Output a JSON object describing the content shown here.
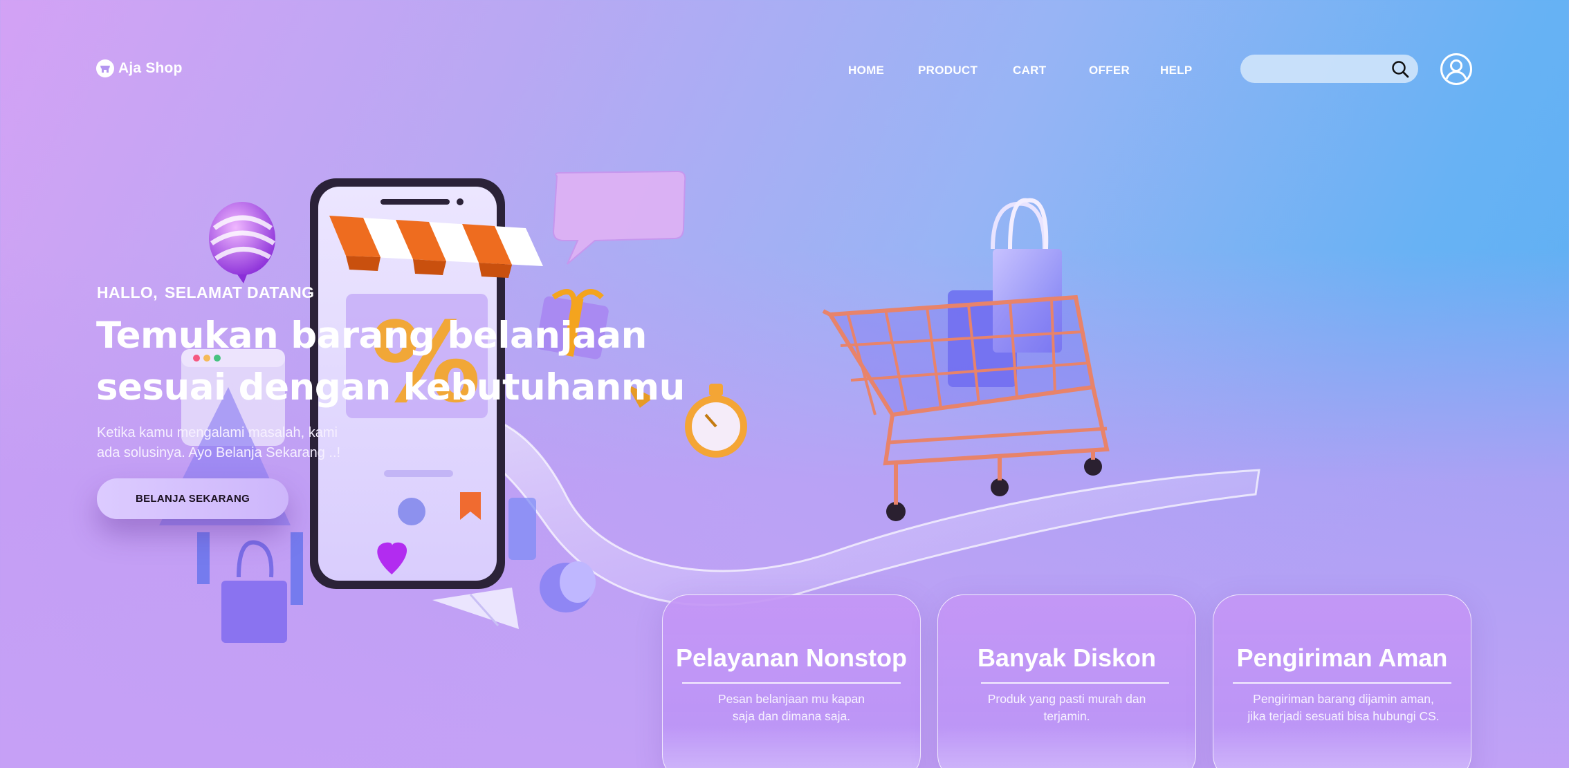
{
  "brand": {
    "name": "Aja Shop",
    "icon": "shop-icon"
  },
  "nav": {
    "items": [
      {
        "label": "HOME"
      },
      {
        "label": "PRODUCT"
      },
      {
        "label": "CART"
      },
      {
        "label": "OFFER"
      },
      {
        "label": "HELP"
      }
    ]
  },
  "search": {
    "placeholder": "",
    "icon": "search-icon"
  },
  "profile": {
    "icon": "user-profile-icon"
  },
  "hero": {
    "greeting_1": "HALLO,",
    "greeting_2": "SELAMAT DATANG",
    "title_line_1": "Temukan barang belanjaan",
    "title_line_2": "sesuai dengan kebutuhanmu",
    "desc_line_1": "Ketika kamu mengalami masalah, kami",
    "desc_line_2": "ada solusinya. Ayo Belanja Sekarang ..!",
    "cta_label": "BELANJA SEKARANG"
  },
  "features": [
    {
      "title": "Pelayanan Nonstop",
      "desc_line_1": "Pesan belanjaan mu kapan",
      "desc_line_2": "saja dan dimana saja."
    },
    {
      "title": "Banyak Diskon",
      "desc_line_1": "Produk yang pasti murah dan",
      "desc_line_2": "terjamin."
    },
    {
      "title": "Pengiriman Aman",
      "desc_line_1": "Pengiriman barang dijamin aman,",
      "desc_line_2": "jika terjadi sesuati bisa hubungi CS."
    }
  ],
  "colors": {
    "accent": "#ffffff",
    "cta_bg": "#d4c1fd",
    "bg_left": "#d3a2f5",
    "bg_right": "#5aaef2"
  }
}
